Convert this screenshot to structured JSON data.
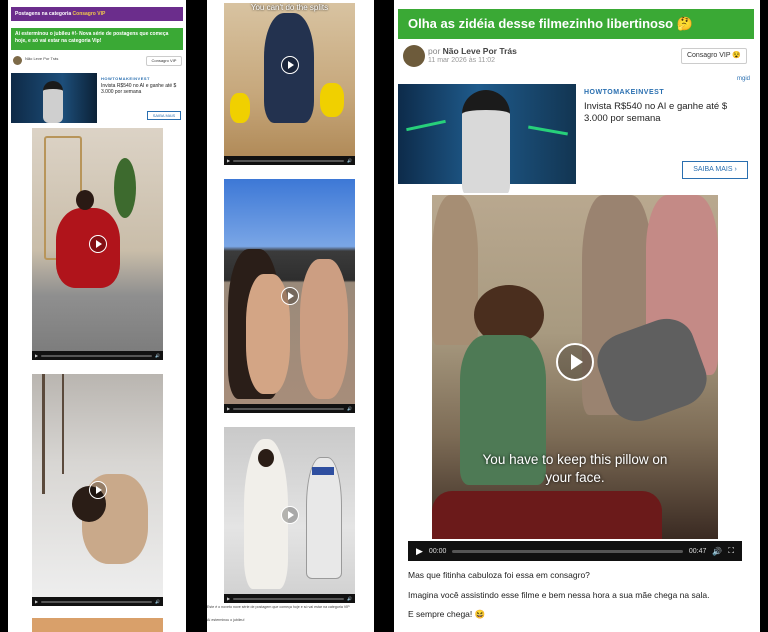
{
  "colors": {
    "purple": "#6b2d8c",
    "green": "#3aa935",
    "link": "#2a6fb0",
    "vip": "#d4b11a"
  },
  "col1": {
    "category_prefix": "Postagens na categoria ",
    "category_name": "Consagro VIP",
    "post_title": "Aí esterminou o jubileu #!- Nova série de postagens que começa hoje, e só vai estar na categoria Vip!",
    "author": "Não Leve Por Trás",
    "vip_label": "Consagro VIP",
    "ad": {
      "brand": "HOWTOMAKEINVEST",
      "text": "Invista R$540 no AI e ganhe até $ 3.000 por semana",
      "button": "SAIBA MAIS"
    }
  },
  "col2": {
    "caption_top": "You can't do the splits",
    "footer_text": "Este é o noveto nove série de postagem que começa hoje e só vai estar na categoria VIP",
    "footer_line2": "Aí esterminou o jubileu!"
  },
  "col3": {
    "title": "Olha as zidéia desse filmezinho libertinoso 🤔",
    "author_prefix": "por ",
    "author": "Não Leve Por Trás",
    "date": "11 mar 2026 às 11:02",
    "vip_label": "Consagro VIP 😵",
    "ad_tag": "mgid",
    "ad": {
      "brand": "HOWTOMAKEINVEST",
      "text": "Invista R$540 no AI e ganhe até $ 3.000 por semana",
      "button": "SAIBA MAIS"
    },
    "video_caption": "You have to keep this pillow on your face.",
    "time_current": "00:00",
    "time_total": "00:47",
    "paragraph1": "Mas que fitinha cabuloza foi essa em consagro?",
    "paragraph2": "Imagina você assistindo esse filme e bem nessa hora a sua mãe chega na sala.",
    "paragraph3": "E sempre chega! 😆"
  }
}
